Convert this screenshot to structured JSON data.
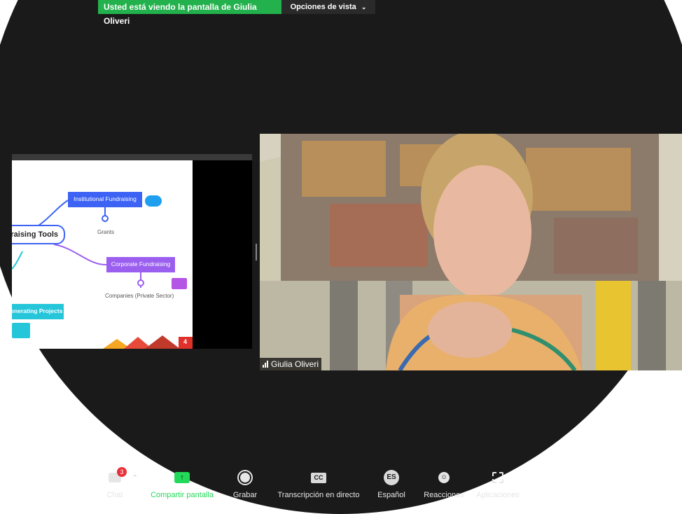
{
  "banner": {
    "text": "Usted está viendo la pantalla de Giulia Oliveri"
  },
  "view_options": {
    "label": "Opciones de vista"
  },
  "slide": {
    "title": "draising Tools",
    "node_institutional": "Institutional Fundraising",
    "label_grants": "Grants",
    "node_corporate": "Corporate Fundraising",
    "label_companies": "Companies (Private Sector)",
    "node_generating": "Generating Projects",
    "page_number": "4"
  },
  "participant": {
    "name": "Giulia Oliveri"
  },
  "toolbar": {
    "chat": {
      "label": "Chat",
      "badge": "3"
    },
    "share": {
      "label": "Compartir pantalla"
    },
    "record": {
      "label": "Grabar"
    },
    "transcription": {
      "label": "Transcripción en directo",
      "icon_text": "CC"
    },
    "language": {
      "label": "Español",
      "icon_text": "ES"
    },
    "reactions": {
      "label": "Reacciones"
    },
    "apps": {
      "label": "Aplicaciones"
    }
  },
  "colors": {
    "banner_green": "#22b14c",
    "share_green": "#23d959",
    "badge_red": "#e8303a",
    "node_blue": "#3d63f5",
    "node_purple": "#9b5ff0",
    "node_teal": "#26c6da"
  }
}
